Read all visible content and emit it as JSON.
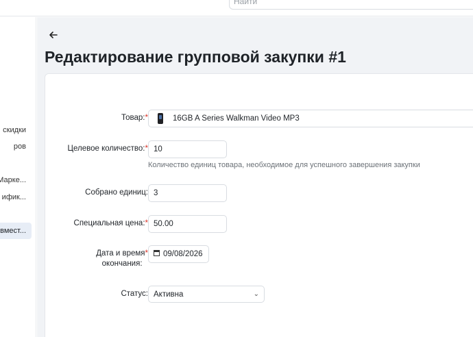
{
  "search": {
    "placeholder": "Найти"
  },
  "sidebar": {
    "items": [
      {
        "label": "скидки"
      },
      {
        "label": "ров"
      },
      {
        "label": "Марке..."
      },
      {
        "label": "ифик..."
      },
      {
        "label": "вмест..."
      }
    ]
  },
  "page": {
    "title": "Редактирование групповой закупки #1"
  },
  "form": {
    "product": {
      "label": "Товар:",
      "value": "16GB A Series Walkman Video MP3"
    },
    "target_qty": {
      "label": "Целевое количество:",
      "value": "10",
      "hint": "Количество единиц товара, необходимое для успешного завершения закупки"
    },
    "collected": {
      "label": "Собрано единиц:",
      "value": "3"
    },
    "special_price": {
      "label": "Специальная цена:",
      "value": "50.00"
    },
    "end_date": {
      "label_line1": "Дата и время",
      "label_line2": "окончания:",
      "value": "09/08/2026"
    },
    "status": {
      "label": "Статус:",
      "value": "Активна"
    },
    "required_mark": "*"
  }
}
